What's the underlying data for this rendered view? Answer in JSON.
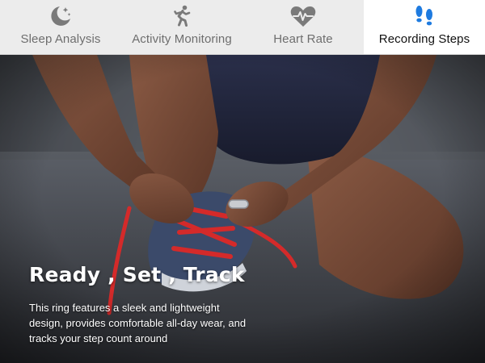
{
  "tabs": [
    {
      "label": "Sleep Analysis",
      "icon": "moon-stars-icon",
      "active": false
    },
    {
      "label": "Activity Monitoring",
      "icon": "running-person-icon",
      "active": false
    },
    {
      "label": "Heart Rate",
      "icon": "heartbeat-icon",
      "active": false
    },
    {
      "label": "Recording Steps",
      "icon": "footprints-icon",
      "active": true
    }
  ],
  "hero": {
    "headline": "Ready , Set , Track",
    "description": "This ring features a sleek and lightweight design, provides comfortable all-day wear, and tracks your step count around"
  },
  "colors": {
    "accent_blue": "#1e7be0",
    "icon_gray": "#7a7a7a",
    "active_tab_bg": "#ffffff",
    "inactive_tab_bg": "#ececec",
    "lace_red": "#d42a2a"
  }
}
